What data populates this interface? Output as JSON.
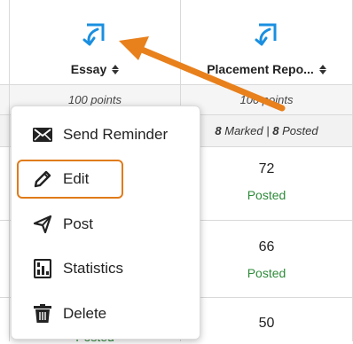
{
  "columns": [
    {
      "title": "Essay",
      "points": "100 points",
      "icon": "external-link-icon"
    },
    {
      "title": "Placement Repo...",
      "points": "100 points",
      "icon": "external-link-icon"
    }
  ],
  "placement_summary": {
    "marked_count": "8",
    "marked_label": "Marked",
    "separator": "|",
    "posted_count": "8",
    "posted_label": "Posted"
  },
  "rows": [
    {
      "score": "72",
      "status": "Posted"
    },
    {
      "score": "66",
      "status": "Posted"
    },
    {
      "score": "50",
      "status": "Posted"
    }
  ],
  "menu": {
    "items": [
      {
        "label": "Send Reminder",
        "icon": "envelope-icon"
      },
      {
        "label": "Edit",
        "icon": "pencil-icon"
      },
      {
        "label": "Post",
        "icon": "send-icon"
      },
      {
        "label": "Statistics",
        "icon": "statistics-icon"
      },
      {
        "label": "Delete",
        "icon": "trash-icon"
      }
    ],
    "highlighted": "Edit"
  },
  "colors": {
    "accent_blue": "#1a8fe0",
    "highlight_orange": "#e07b1a",
    "posted_green": "#2e8b3a"
  }
}
